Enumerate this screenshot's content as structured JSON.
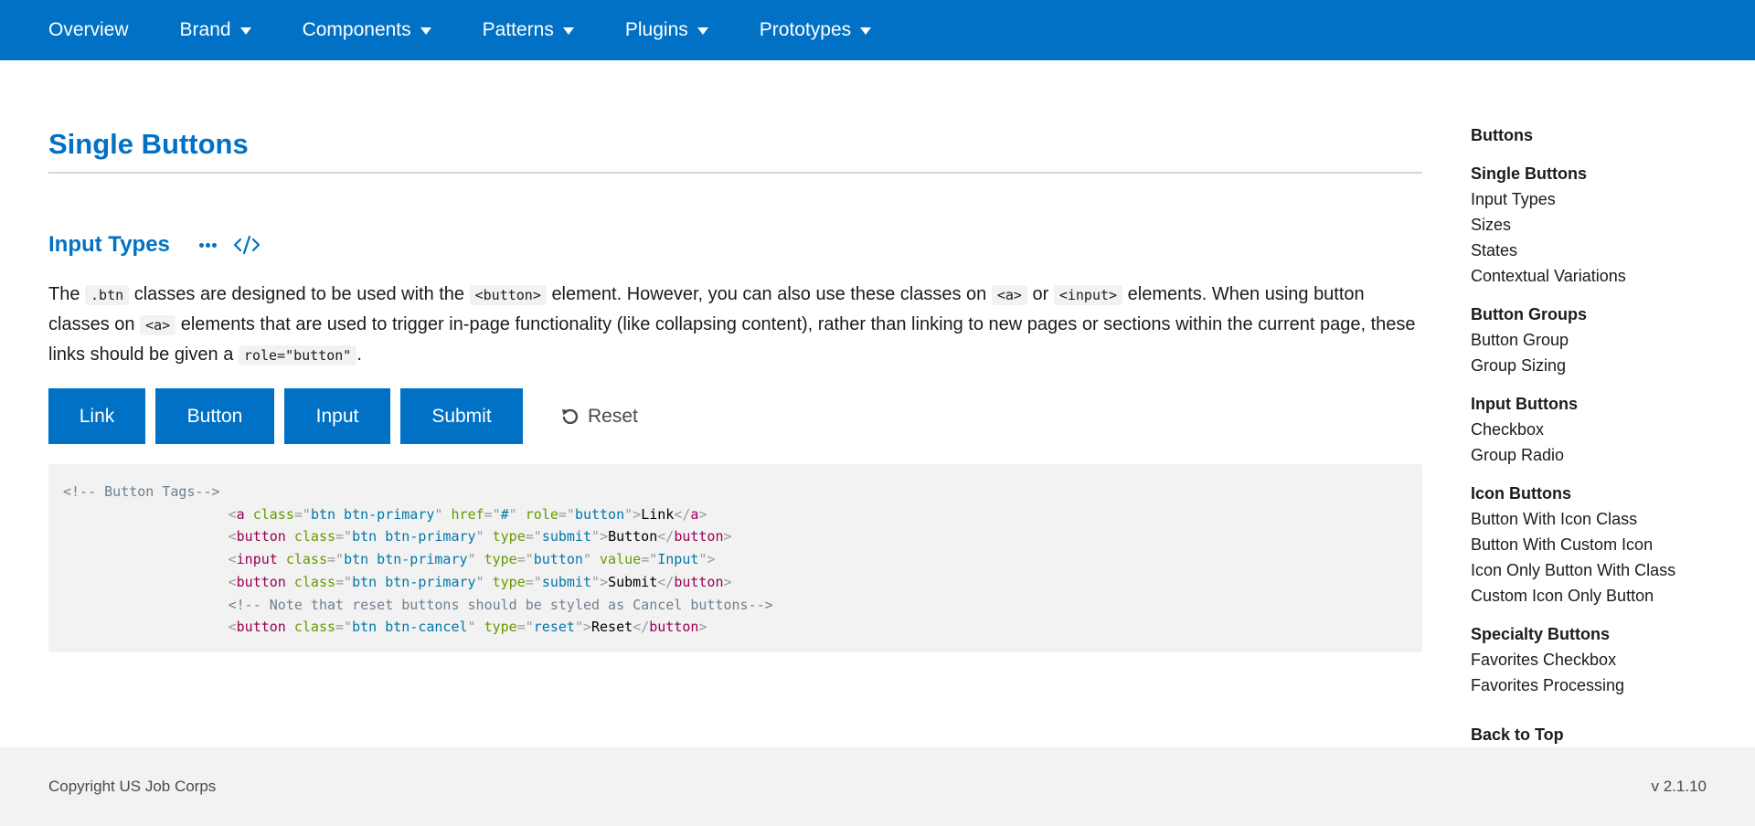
{
  "nav": {
    "items": [
      {
        "label": "Overview",
        "dropdown": false
      },
      {
        "label": "Brand",
        "dropdown": true
      },
      {
        "label": "Components",
        "dropdown": true
      },
      {
        "label": "Patterns",
        "dropdown": true
      },
      {
        "label": "Plugins",
        "dropdown": true
      },
      {
        "label": "Prototypes",
        "dropdown": true
      }
    ]
  },
  "main": {
    "page_title": "Single Buttons",
    "section_title": "Input Types",
    "description": {
      "t1": "The",
      "c1": ".btn",
      "t2": "classes are designed to be used with the",
      "c2": "<button>",
      "t3": "element. However, you can also use these classes on",
      "c3": "<a>",
      "t4": "or",
      "c4": "<input>",
      "t5": "elements. When using button classes on",
      "c5": "<a>",
      "t6": "elements that are used to trigger in-page functionality (like collapsing content), rather than linking to new pages or sections within the current page, these links should be given a",
      "c6": "role=\"button\"",
      "t7": "."
    },
    "buttons": {
      "link": "Link",
      "button": "Button",
      "input": "Input",
      "submit": "Submit",
      "reset": "Reset"
    },
    "code": {
      "comment1": "<!-- Button Tags-->",
      "line_a_text": "Link",
      "line_button_text": "Button",
      "line_input_value": "Input",
      "line_submit_text": "Submit",
      "comment2": "<!-- Note that reset buttons should be styled as Cancel buttons-->",
      "line_reset_text": "Reset"
    }
  },
  "sidebar": {
    "groups": [
      {
        "head": "Buttons",
        "items": []
      },
      {
        "head": "Single Buttons",
        "items": [
          "Input Types",
          "Sizes",
          "States",
          "Contextual Variations"
        ]
      },
      {
        "head": "Button Groups",
        "items": [
          "Button Group",
          "Group Sizing"
        ]
      },
      {
        "head": "Input Buttons",
        "items": [
          "Checkbox",
          "Group Radio"
        ]
      },
      {
        "head": "Icon Buttons",
        "items": [
          "Button With Icon Class",
          "Button With Custom Icon",
          "Icon Only Button With Class",
          "Custom Icon Only Button"
        ]
      },
      {
        "head": "Specialty Buttons",
        "items": [
          "Favorites Checkbox",
          "Favorites Processing"
        ]
      }
    ],
    "back_to_top": "Back to Top"
  },
  "footer": {
    "copyright": "Copyright US Job Corps",
    "version": "v 2.1.10"
  },
  "colors": {
    "brand_blue": "#0071c5",
    "footer_bg": "#f2f2f2",
    "code_bg": "#f2f2f2"
  },
  "icons": [
    "caret-down-icon",
    "more-dots-icon",
    "code-icon",
    "reset-icon"
  ]
}
